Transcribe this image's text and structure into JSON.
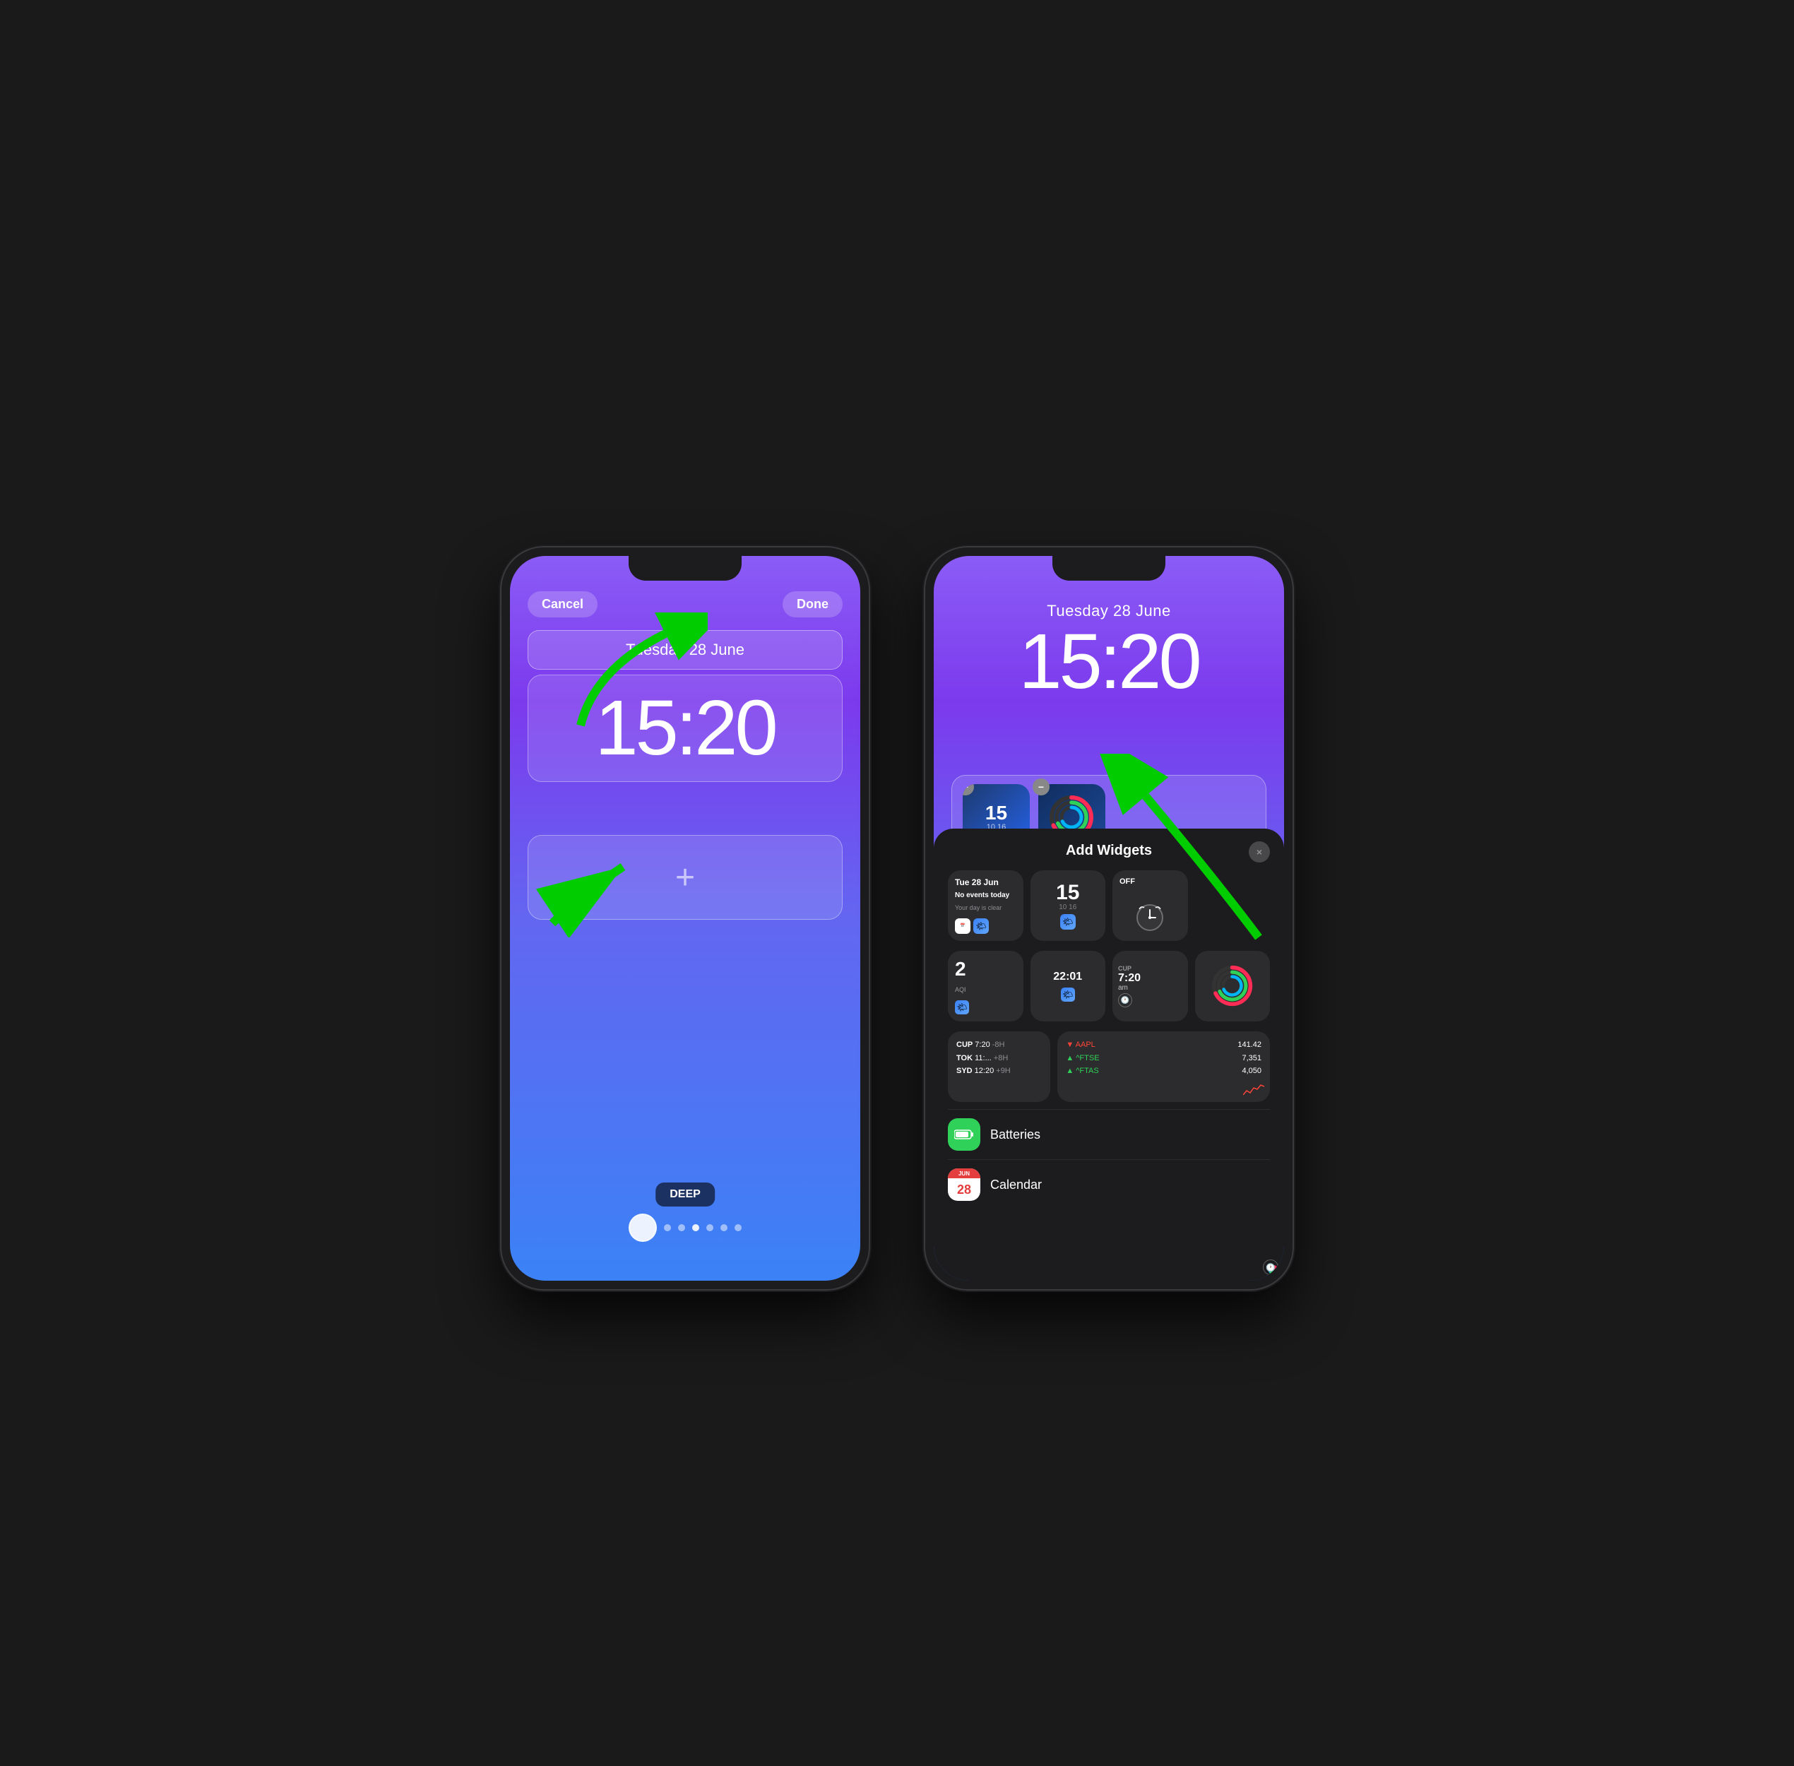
{
  "phone1": {
    "cancel_label": "Cancel",
    "done_label": "Done",
    "date": "Tuesday 28 June",
    "time": "15:20",
    "wallpaper_label": "DEEP"
  },
  "phone2": {
    "date": "Tuesday 28 June",
    "time": "15:20",
    "widgets_panel": {
      "title": "Add Widgets",
      "close_label": "×",
      "calendar_widget": {
        "date": "Tue 28 Jun",
        "no_events": "No events today",
        "clear": "Your day is clear"
      },
      "clock_widget": {
        "number": "15",
        "sub": "10  16"
      },
      "alarm_widget": {
        "label": "OFF"
      },
      "aqi_widget": {
        "value": "2",
        "label": "AQI"
      },
      "worldclock_widget": {
        "time": "22:01"
      },
      "cup_widget": {
        "label": "CUP",
        "time": "7:20",
        "ampm": "am"
      },
      "stocks_widget": {
        "markets": [
          "CUP",
          "TOK",
          "SYD"
        ],
        "times": [
          "7:20",
          "11:...",
          "12:20"
        ],
        "changes": [
          "-8H",
          "+8H",
          "+9H"
        ],
        "stocks": [
          "▼ AAPL",
          "▲ ^FTSE",
          "▲ ^FTAS"
        ],
        "values": [
          "141.42",
          "7,351",
          "4,050"
        ]
      },
      "batteries_label": "Batteries",
      "calendar_label": "Calendar"
    }
  }
}
